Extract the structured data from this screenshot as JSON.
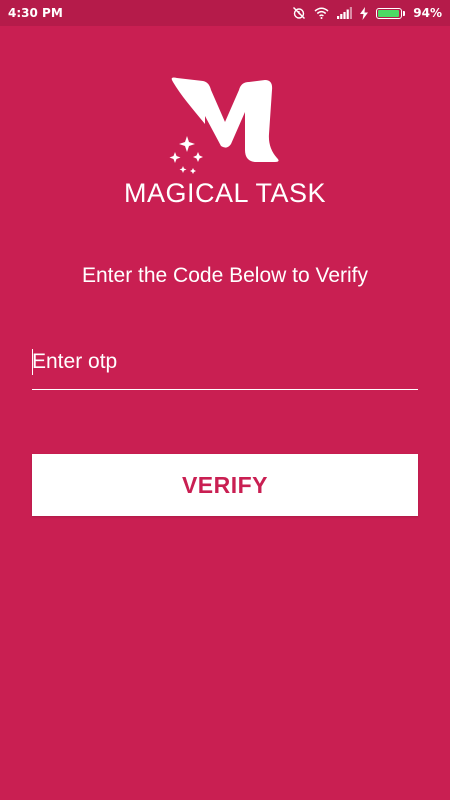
{
  "status_bar": {
    "time": "4:30 PM",
    "battery_percent": "94%",
    "battery_level": 0.94,
    "icons": [
      "alarm-off-icon",
      "wifi-icon",
      "signal-icon",
      "charging-icon",
      "battery-icon"
    ]
  },
  "app": {
    "name": "MAGICAL TASK",
    "logo_icon": "magic-m-logo-icon"
  },
  "verify_screen": {
    "instruction": "Enter the Code Below to Verify",
    "otp_placeholder": "Enter otp",
    "otp_value": "",
    "verify_label": "VERIFY"
  },
  "colors": {
    "background": "#c91f52",
    "status_bar": "#b51b4a",
    "button_bg": "#ffffff",
    "button_text": "#c91f52",
    "battery_fill": "#4cd964"
  }
}
